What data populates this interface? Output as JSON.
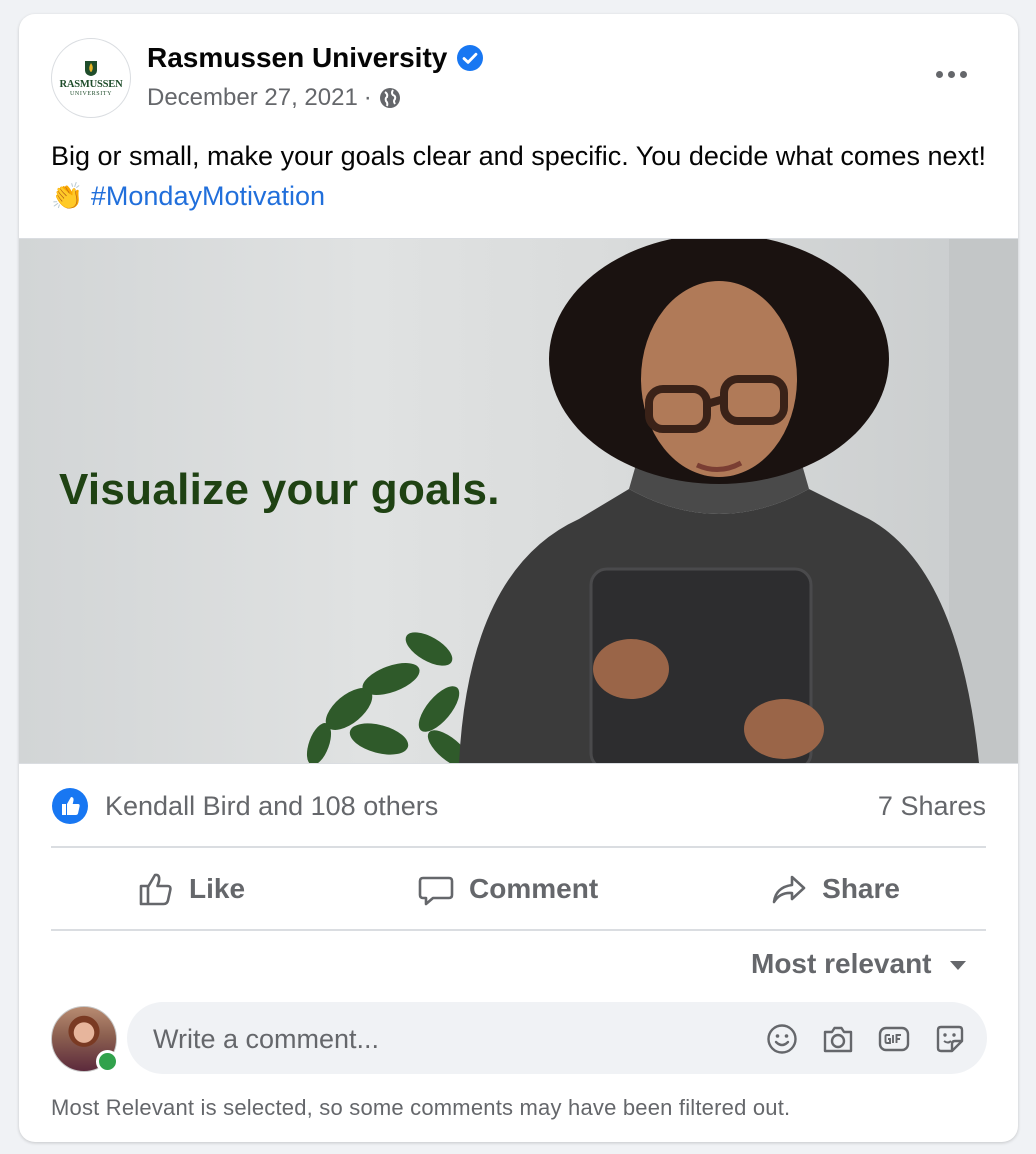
{
  "post": {
    "page_name": "Rasmussen University",
    "logo_text": "RASMUSSEN",
    "logo_subtext": "UNIVERSITY",
    "date": "December 27, 2021",
    "separator": "·",
    "text": "Big or small, make your goals clear and specific. You decide what comes next!",
    "emoji": "👏",
    "hashtag": "#MondayMotivation",
    "image_headline": "Visualize your goals."
  },
  "reactions": {
    "summary": "Kendall Bird and 108 others",
    "shares": "7 Shares"
  },
  "actions": {
    "like": "Like",
    "comment": "Comment",
    "share": "Share"
  },
  "comments": {
    "sort_label": "Most relevant",
    "placeholder": "Write a comment...",
    "filter_note": "Most Relevant is selected, so some comments may have been filtered out."
  },
  "colors": {
    "accent": "#1877f2",
    "hashtag": "#216fdb",
    "secondary_text": "#65676b",
    "headline": "#1f4213",
    "online": "#31a24c"
  },
  "icons": [
    "verified-icon",
    "globe-icon",
    "more-icon",
    "like-reaction-icon",
    "thumbs-up-icon",
    "comment-icon",
    "share-icon",
    "emoji-icon",
    "camera-icon",
    "gif-icon",
    "sticker-icon"
  ]
}
